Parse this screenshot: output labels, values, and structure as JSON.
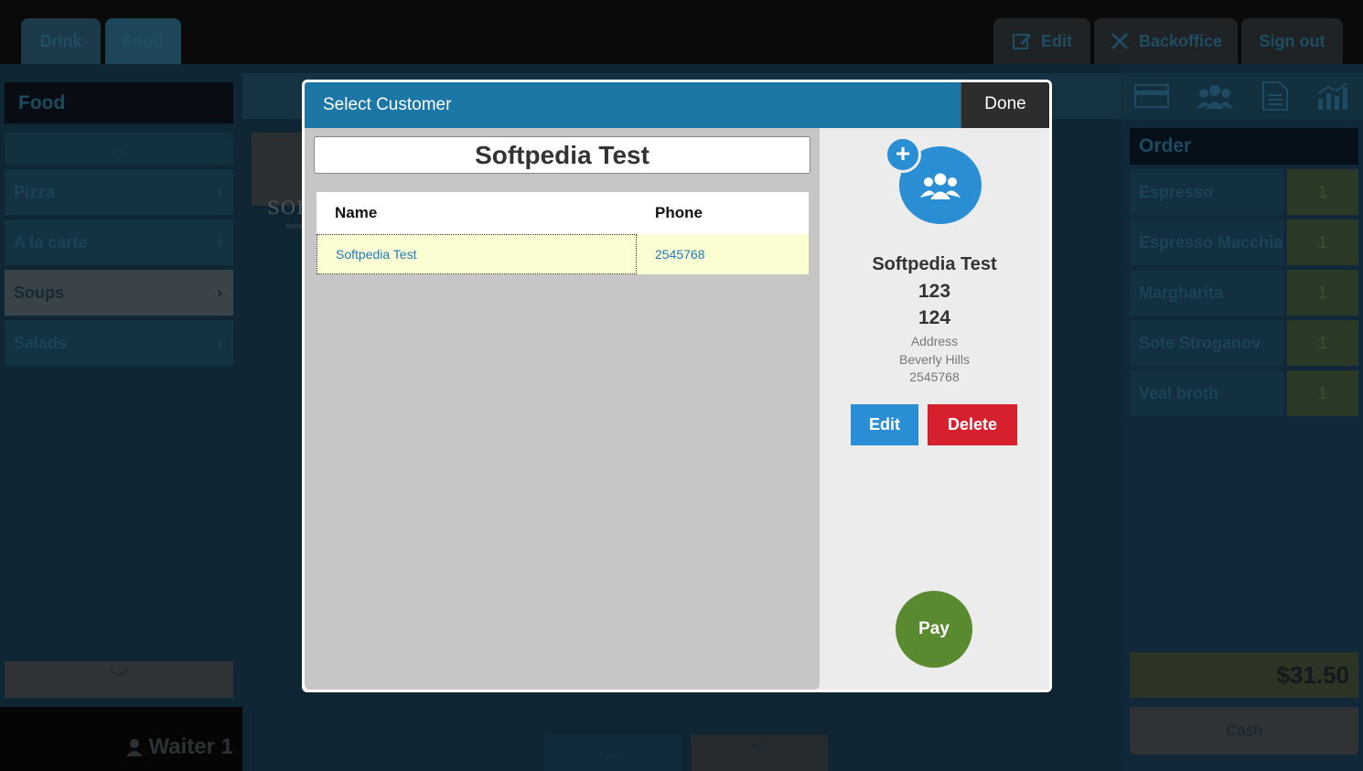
{
  "top_tabs": [
    {
      "label": "Drink"
    },
    {
      "label": "Food"
    }
  ],
  "top_actions": {
    "edit_label": "Edit",
    "backoffice_label": "Backoffice",
    "signout_label": "Sign out"
  },
  "left": {
    "category_title": "Food",
    "categories": [
      {
        "label": "Pizza"
      },
      {
        "label": "A la carte"
      },
      {
        "label": "Soups"
      },
      {
        "label": "Salads"
      }
    ],
    "active_category": "Soups",
    "waiter": "Waiter 1"
  },
  "watermark": {
    "text": "SOFTPEDIA",
    "sub": "www.softpedia.com"
  },
  "order": {
    "title": "Order",
    "items": [
      {
        "name": "Espresso",
        "qty": "1"
      },
      {
        "name": "Espresso Macchiato",
        "qty": "1"
      },
      {
        "name": "Margharita",
        "qty": "1"
      },
      {
        "name": "Sote Stroganov",
        "qty": "1"
      },
      {
        "name": "Veal broth",
        "qty": "1"
      }
    ],
    "total": "$31.50",
    "cash_label": "Cash"
  },
  "modal": {
    "title": "Select Customer",
    "done_label": "Done",
    "search_value": "Softpedia Test",
    "columns": {
      "name": "Name",
      "phone": "Phone"
    },
    "rows": [
      {
        "name": "Softpedia Test",
        "phone": "2545768"
      }
    ],
    "detail": {
      "name": "Softpedia Test",
      "line1": "123",
      "line2": "124",
      "address_label": "Address",
      "city": "Beverly Hills",
      "phone": "2545768",
      "edit_label": "Edit",
      "delete_label": "Delete",
      "pay_label": "Pay"
    }
  },
  "colors": {
    "header_blue": "#1c77a6",
    "edit_blue": "#2a8ed4",
    "delete_red": "#d6202d",
    "pay_green": "#5a8a2f",
    "row_highlight": "#fdfdd3"
  }
}
